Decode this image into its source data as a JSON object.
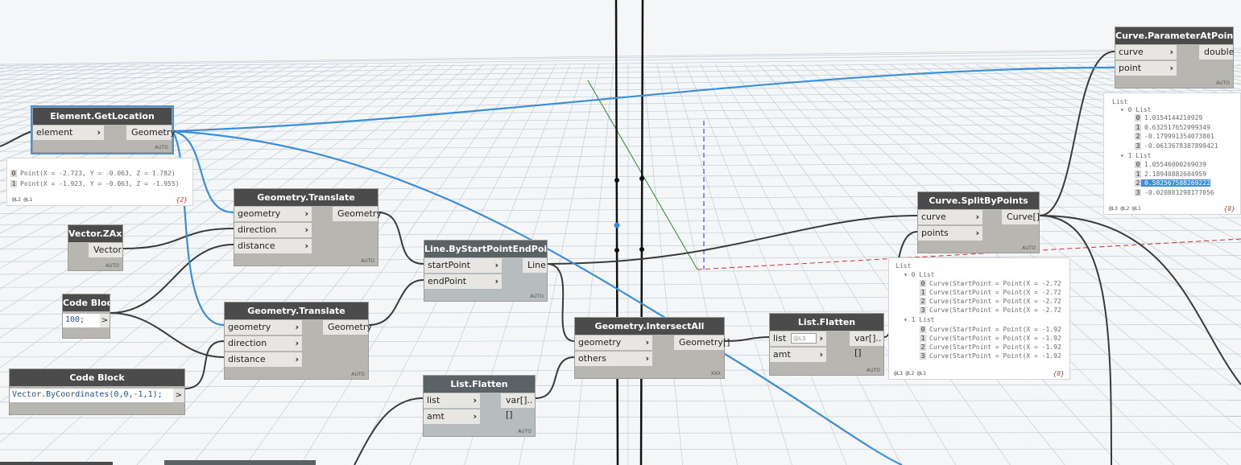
{
  "nodes": {
    "element_get_location": {
      "title": "Element.GetLocation",
      "in1": "element",
      "out1": "Geometry",
      "lacing": "AUTO"
    },
    "vector_zaxis": {
      "title": "Vector.ZAxis",
      "out1": "Vector",
      "lacing": "AUTO"
    },
    "code_block_1": {
      "title": "Code Block",
      "code": "100;",
      "out": ">"
    },
    "code_block_2": {
      "title": "Code Block",
      "code": "Vector.ByCoordinates(0,0,-1,1);",
      "out": ">"
    },
    "geometry_translate_1": {
      "title": "Geometry.Translate",
      "in1": "geometry",
      "in2": "direction",
      "in3": "distance",
      "out1": "Geometry",
      "lacing": "AUTO"
    },
    "geometry_translate_2": {
      "title": "Geometry.Translate",
      "in1": "geometry",
      "in2": "direction",
      "in3": "distance",
      "out1": "Geometry",
      "lacing": "AUTO"
    },
    "line_by_start_end": {
      "title": "Line.ByStartPointEndPoint",
      "in1": "startPoint",
      "in2": "endPoint",
      "out1": "Line",
      "lacing": "AUTO"
    },
    "list_flatten_1": {
      "title": "List.Flatten",
      "in1": "list",
      "in2": "amt",
      "out1": "var[]..[]",
      "lacing": "AUTO"
    },
    "geometry_intersect_all": {
      "title": "Geometry.IntersectAll",
      "in1": "geometry",
      "in2": "others",
      "out1": "Geometry[]",
      "lacing": "XXX"
    },
    "list_flatten_2": {
      "title": "List.Flatten",
      "in1": "list",
      "level": "@L3",
      "in2": "amt",
      "out1": "var[]..[]",
      "lacing": "AUTO"
    },
    "curve_split_by_points": {
      "title": "Curve.SplitByPoints",
      "in1": "curve",
      "in2": "points",
      "out1": "Curve[]",
      "lacing": "AUTO"
    },
    "curve_parameter_at_point": {
      "title": "Curve.ParameterAtPoint",
      "in1": "curve",
      "in2": "point",
      "out1": "double",
      "lacing": "AUTO"
    }
  },
  "preview_location": {
    "lines": [
      {
        "idx": "0",
        "text": "Point(X = -2.723, Y = -0.063, Z = 1.782)"
      },
      {
        "idx": "1",
        "text": "Point(X = -1.923, Y = -0.063, Z = -1.955)"
      }
    ],
    "levels": "@L2 @L1",
    "count": "{2}"
  },
  "preview_parameters": {
    "root": "List",
    "group0": "0 List",
    "group0_items": [
      {
        "idx": "0",
        "text": "1.0154144210929"
      },
      {
        "idx": "1",
        "text": "0.632517652099349"
      },
      {
        "idx": "2",
        "text": "-0.179991354073801"
      },
      {
        "idx": "3",
        "text": "-0.0613678387899421"
      }
    ],
    "group1": "1 List",
    "group1_items": [
      {
        "idx": "0",
        "text": "1.05546000269039"
      },
      {
        "idx": "1",
        "text": "2.18940882604959"
      },
      {
        "idx": "2",
        "text": "0.582567588269222"
      },
      {
        "idx": "3",
        "text": "-0.020881298177056"
      }
    ],
    "levels": "@L3 @L2 @L1",
    "count": "{8}"
  },
  "preview_curves": {
    "root": "List",
    "group0": "0 List",
    "group0_items": [
      {
        "idx": "0",
        "text": "Curve(StartPoint = Point(X = -2.72"
      },
      {
        "idx": "1",
        "text": "Curve(StartPoint = Point(X = -2.72"
      },
      {
        "idx": "2",
        "text": "Curve(StartPoint = Point(X = -2.72"
      },
      {
        "idx": "3",
        "text": "Curve(StartPoint = Point(X = -2.72"
      }
    ],
    "group1": "1 List",
    "group1_items": [
      {
        "idx": "0",
        "text": "Curve(StartPoint = Point(X = -1.92"
      },
      {
        "idx": "1",
        "text": "Curve(StartPoint = Point(X = -1.92"
      },
      {
        "idx": "2",
        "text": "Curve(StartPoint = Point(X = -1.92"
      },
      {
        "idx": "3",
        "text": "Curve(StartPoint = Point(X = -1.92"
      }
    ],
    "levels": "@L3 @L2 @L1",
    "count": "{8}"
  },
  "colors": {
    "wire": "#3a3a3a",
    "selected_wire": "#3b8fd9",
    "node_header": "#4b4b4b",
    "node_body": "#b8b6b0",
    "grid": "#b9c7d3"
  }
}
